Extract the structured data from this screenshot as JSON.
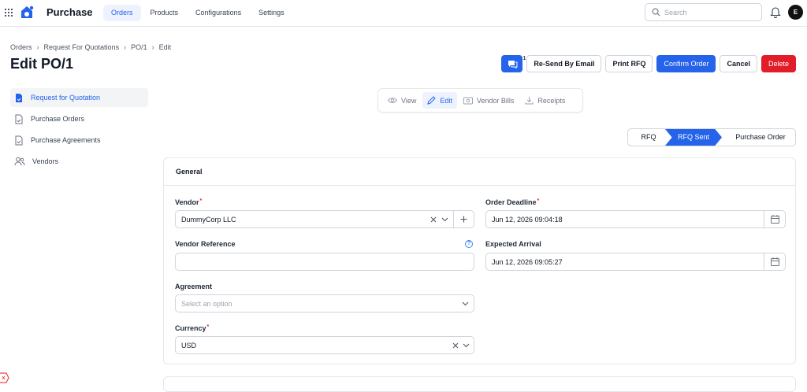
{
  "app": {
    "title": "Purchase"
  },
  "nav": [
    {
      "label": "Orders",
      "active": true
    },
    {
      "label": "Products"
    },
    {
      "label": "Configurations"
    },
    {
      "label": "Settings"
    }
  ],
  "search": {
    "placeholder": "Search"
  },
  "user": {
    "initial": "E"
  },
  "breadcrumb": [
    "Orders",
    "Request For Quotations",
    "PO/1",
    "Edit"
  ],
  "page": {
    "title": "Edit PO/1"
  },
  "actions": {
    "chat_count": "1",
    "resend": "Re-Send By Email",
    "print": "Print RFQ",
    "confirm": "Confirm Order",
    "cancel": "Cancel",
    "delete": "Delete"
  },
  "sidebar": {
    "items": [
      {
        "label": "Request for Quotation",
        "icon": "document-icon",
        "active": true
      },
      {
        "label": "Purchase Orders",
        "icon": "document-check-icon"
      },
      {
        "label": "Purchase Agreements",
        "icon": "document-check-icon"
      },
      {
        "label": "Vendors",
        "icon": "users-icon"
      }
    ]
  },
  "view_tabs": [
    {
      "label": "View",
      "icon": "eye-icon"
    },
    {
      "label": "Edit",
      "icon": "pencil-icon",
      "active": true
    },
    {
      "label": "Vendor Bills",
      "icon": "banknote-icon"
    },
    {
      "label": "Receipts",
      "icon": "download-icon"
    }
  ],
  "status_steps": [
    "RFQ",
    "RFQ Sent",
    "Purchase Order"
  ],
  "status_active": "RFQ Sent",
  "form": {
    "section_title": "General",
    "vendor": {
      "label": "Vendor",
      "value": "DummyCorp LLC",
      "required": true
    },
    "vendor_reference": {
      "label": "Vendor Reference",
      "value": ""
    },
    "agreement": {
      "label": "Agreement",
      "placeholder": "Select an option"
    },
    "currency": {
      "label": "Currency",
      "value": "USD",
      "required": true
    },
    "order_deadline": {
      "label": "Order Deadline",
      "value": "Jun 12, 2026 09:04:18",
      "required": true
    },
    "expected_arrival": {
      "label": "Expected Arrival",
      "value": "Jun 12, 2026 09:05:27"
    },
    "required_mark": "*",
    "help_mark": "?"
  },
  "colors": {
    "accent": "#2563eb",
    "danger": "#e11d2a",
    "required": "#dc2626"
  }
}
